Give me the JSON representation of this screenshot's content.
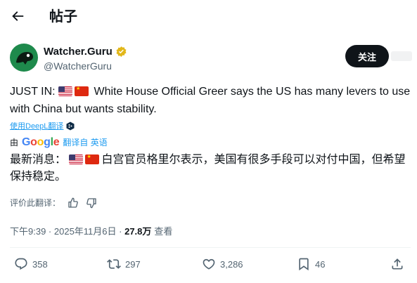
{
  "header": {
    "back_icon": "arrow-left-icon",
    "title": "帖子"
  },
  "author": {
    "display_name": "Watcher.Guru",
    "handle": "@WatcherGuru",
    "verified_icon": "gold-verified-badge-icon",
    "follow_label": "关注"
  },
  "tweet": {
    "text_prefix": "JUST IN: ",
    "text_body": " White House Official Greer says the US has many levers to use with China but wants stability.",
    "translate_link": "使用DeepL翻译",
    "google_prefix": "由",
    "google_word": "Google",
    "google_suffix": "翻译自 英语",
    "translated_prefix": "最新消息：",
    "translated_body": "白宫官员格里尔表示，美国有很多手段可以对付中国，但希望保持稳定。",
    "rate_label": "评价此翻译："
  },
  "meta": {
    "time": "下午9:39",
    "sep": " · ",
    "date": "2025年11月6日",
    "views": "27.8万",
    "views_label": "查看"
  },
  "actions": {
    "replies": "358",
    "reposts": "297",
    "likes": "3,286",
    "bookmarks": "46"
  },
  "colors": {
    "accent": "#1d9bf0",
    "text": "#0f1419",
    "muted": "#536471",
    "verified": "#e2b719"
  }
}
